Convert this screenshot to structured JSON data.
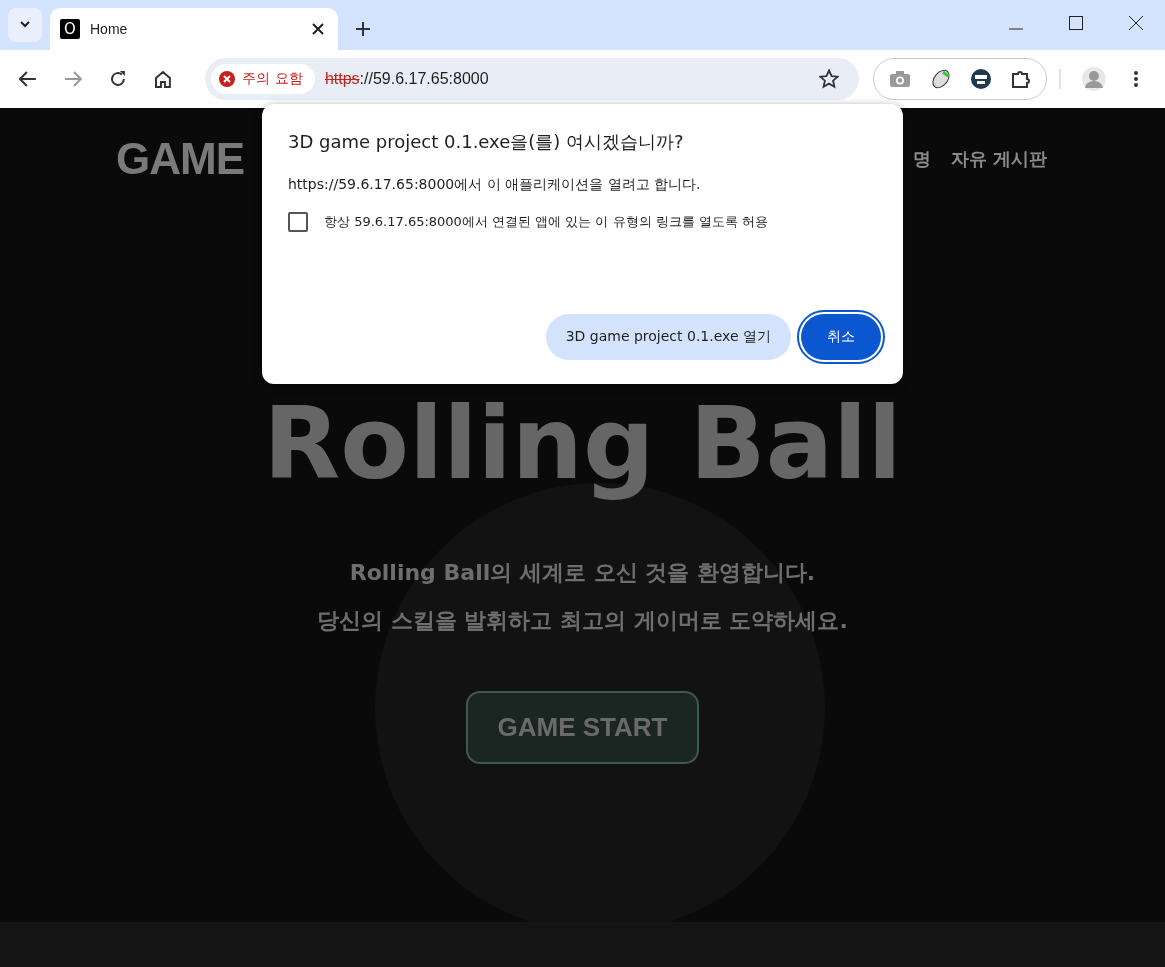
{
  "browser": {
    "tab": {
      "favicon": "O",
      "title": "Home",
      "selected": true
    },
    "security_chip": "주의 요함",
    "url_scheme": "https",
    "url_rest": "://59.6.17.65:8000"
  },
  "site": {
    "logo": "GAME",
    "nav": [
      "명",
      "자유 게시판"
    ],
    "title": "Rolling Ball",
    "subtitle_lines": [
      "**Rolling Ball**의 세계로 오신 것을 환영합니다.",
      "당신의 스킬을 발휘하고 최고의 게이머로 도약하세요."
    ],
    "cta": "GAME START"
  },
  "dialog": {
    "title": "3D game project 0.1.exe을(를) 여시겠습니까?",
    "message": "https://59.6.17.65:8000에서 이 애플리케이션을 열려고 합니다.",
    "checkbox": {
      "label": "항상 59.6.17.65:8000에서 연결된 앱에 있는 이 유형의 링크를 열도록 허용",
      "checked": false
    },
    "buttons": [
      {
        "label": "3D game project 0.1.exe 열기",
        "kind": "secondary"
      },
      {
        "label": "취소",
        "kind": "primary"
      }
    ]
  }
}
